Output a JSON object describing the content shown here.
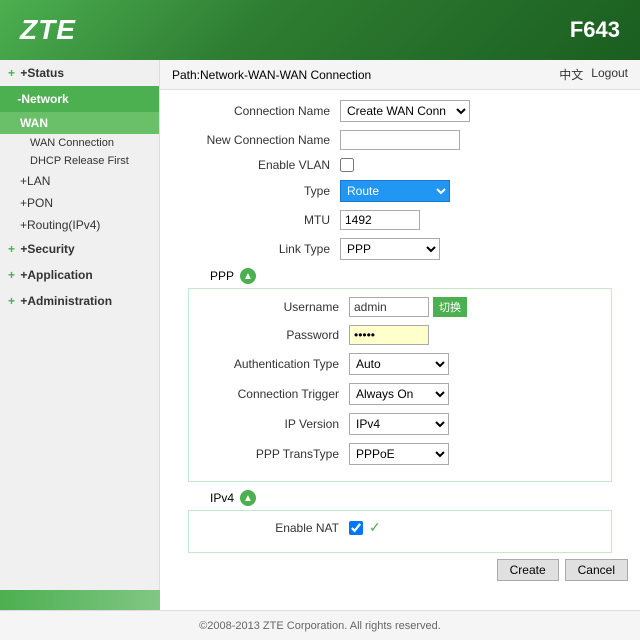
{
  "header": {
    "logo": "ZTE",
    "model": "F643"
  },
  "topbar": {
    "path": "Path:Network-WAN-WAN Connection",
    "lang": "中文",
    "logout": "Logout"
  },
  "sidebar": {
    "items": [
      {
        "id": "status",
        "label": "Status",
        "prefix": "+",
        "active": false
      },
      {
        "id": "network",
        "label": "Network",
        "prefix": "-",
        "active": true
      },
      {
        "id": "wan",
        "label": "WAN",
        "sub": true,
        "active": false
      },
      {
        "id": "wan-connection",
        "label": "WAN Connection",
        "subsub": true,
        "active": true
      },
      {
        "id": "dhcp-release",
        "label": "DHCP Release First",
        "subsub": true,
        "active": false
      },
      {
        "id": "lan",
        "label": "LAN",
        "prefix": "+",
        "sub": true,
        "active": false
      },
      {
        "id": "pon",
        "label": "PON",
        "prefix": "+",
        "sub": true,
        "active": false
      },
      {
        "id": "routing",
        "label": "Routing(IPv4)",
        "prefix": "+",
        "sub": true,
        "active": false
      },
      {
        "id": "security",
        "label": "Security",
        "prefix": "+",
        "active": false
      },
      {
        "id": "application",
        "label": "Application",
        "prefix": "+",
        "active": false
      },
      {
        "id": "administration",
        "label": "Administration",
        "prefix": "+",
        "active": false
      }
    ]
  },
  "form": {
    "connection_name_label": "Connection Name",
    "connection_name_value": "Create WAN Conn",
    "new_connection_name_label": "New Connection Name",
    "new_connection_name_placeholder": "",
    "enable_vlan_label": "Enable VLAN",
    "type_label": "Type",
    "type_value": "Route",
    "mtu_label": "MTU",
    "mtu_value": "1492",
    "link_type_label": "Link Type",
    "link_type_value": "PPP",
    "ppp_section": "PPP",
    "username_label": "Username",
    "username_value": "admin",
    "switch_btn_label": "切换",
    "password_label": "Password",
    "password_value": "•••••",
    "auth_type_label": "Authentication Type",
    "auth_type_value": "Auto",
    "conn_trigger_label": "Connection Trigger",
    "conn_trigger_value": "Always On",
    "ip_version_label": "IP Version",
    "ip_version_value": "IPv4",
    "ppp_transtype_label": "PPP TransType",
    "ppp_transtype_value": "PPPoE",
    "ipv4_section": "IPv4",
    "enable_nat_label": "Enable NAT",
    "create_btn": "Create",
    "cancel_btn": "Cancel"
  },
  "footer": {
    "text": "©2008-2013 ZTE Corporation. All rights reserved."
  }
}
